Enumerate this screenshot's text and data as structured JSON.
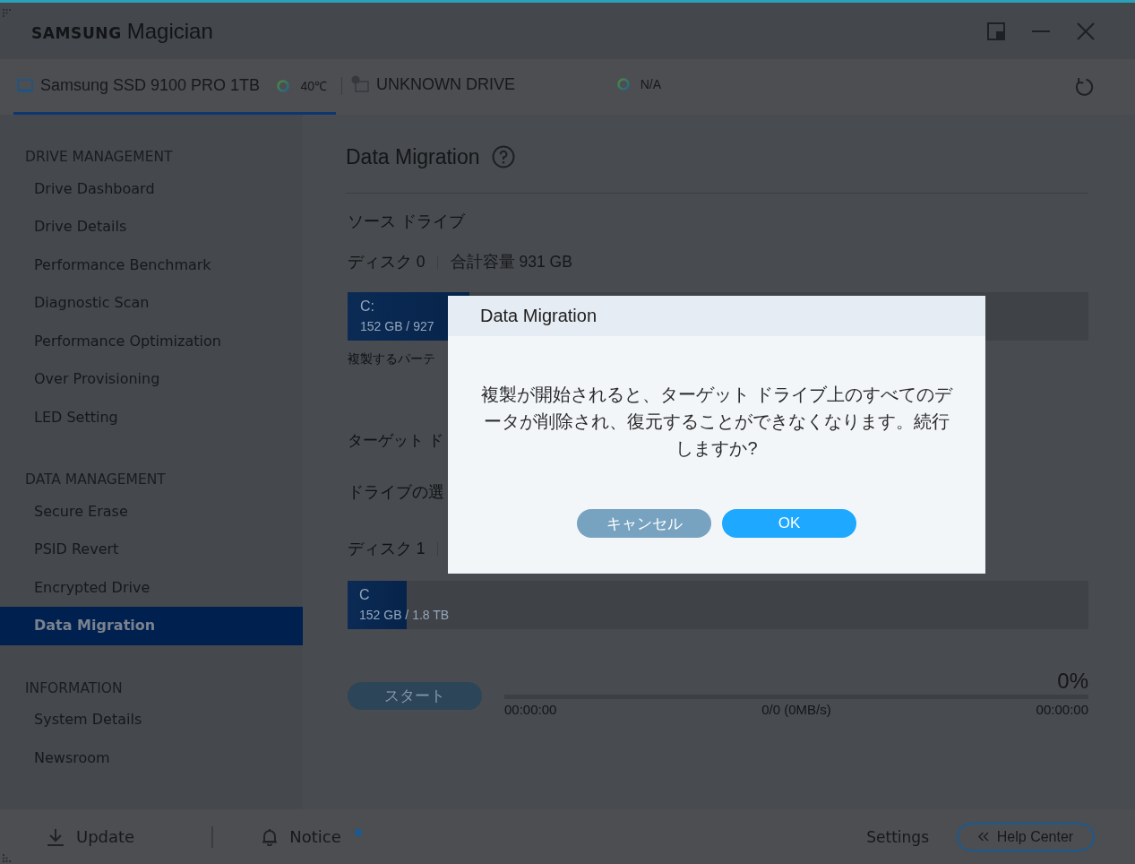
{
  "window": {
    "brand": "SAMSUNG",
    "product": "Magician"
  },
  "drive_tabs": [
    {
      "kind": "ssd",
      "name": "Samsung SSD 9100 PRO 1TB",
      "temperature": "40℃",
      "selected": true
    },
    {
      "kind": "unknown",
      "name": "UNKNOWN DRIVE",
      "temperature": "N/A",
      "selected": false
    }
  ],
  "sidebar": {
    "sections": [
      {
        "title": "DRIVE MANAGEMENT",
        "items": [
          {
            "label": "Drive Dashboard",
            "selected": false
          },
          {
            "label": "Drive Details",
            "selected": false
          },
          {
            "label": "Performance Benchmark",
            "selected": false
          },
          {
            "label": "Diagnostic Scan",
            "selected": false
          },
          {
            "label": "Performance Optimization",
            "selected": false
          },
          {
            "label": "Over Provisioning",
            "selected": false
          },
          {
            "label": "LED Setting",
            "selected": false
          }
        ]
      },
      {
        "title": "DATA MANAGEMENT",
        "items": [
          {
            "label": "Secure Erase",
            "selected": false
          },
          {
            "label": "PSID Revert",
            "selected": false
          },
          {
            "label": "Encrypted Drive",
            "selected": false
          },
          {
            "label": "Data Migration",
            "selected": true
          }
        ]
      },
      {
        "title": "INFORMATION",
        "items": [
          {
            "label": "System Details",
            "selected": false
          },
          {
            "label": "Newsroom",
            "selected": false
          }
        ]
      }
    ]
  },
  "page": {
    "title": "Data Migration",
    "source": {
      "heading": "ソース ドライブ",
      "disk": "ディスク 0",
      "capacity": "合計容量 931 GB",
      "partition": {
        "name": "C:",
        "usage": "152 GB / 927",
        "level": 0.165
      },
      "note": "複製するパーテ"
    },
    "target": {
      "heading": "ターゲット ド",
      "select_label": "ドライブの選",
      "disk": "ディスク 1",
      "partition": {
        "name": "C",
        "usage": "152 GB / 1.8 TB",
        "level": 0.08
      }
    },
    "start": {
      "label": "スタート",
      "disabled": true
    },
    "progress": {
      "percent": "0%",
      "elapsed": "00:00:00",
      "transfer": "0/0 (0MB/s)",
      "remaining": "00:00:00"
    }
  },
  "dialog": {
    "title": "Data Migration",
    "message": "複製が開始されると、ターゲット ドライブ上のすべてのデータが削除され、復元することができなくなります。続行しますか?",
    "buttons": [
      {
        "kind": "secondary",
        "label": "キャンセル"
      },
      {
        "kind": "primary",
        "label": "OK"
      }
    ]
  },
  "footer": {
    "update": "Update",
    "notice": {
      "label": "Notice",
      "unread": true
    },
    "settings": "Settings",
    "help": "Help Center"
  }
}
